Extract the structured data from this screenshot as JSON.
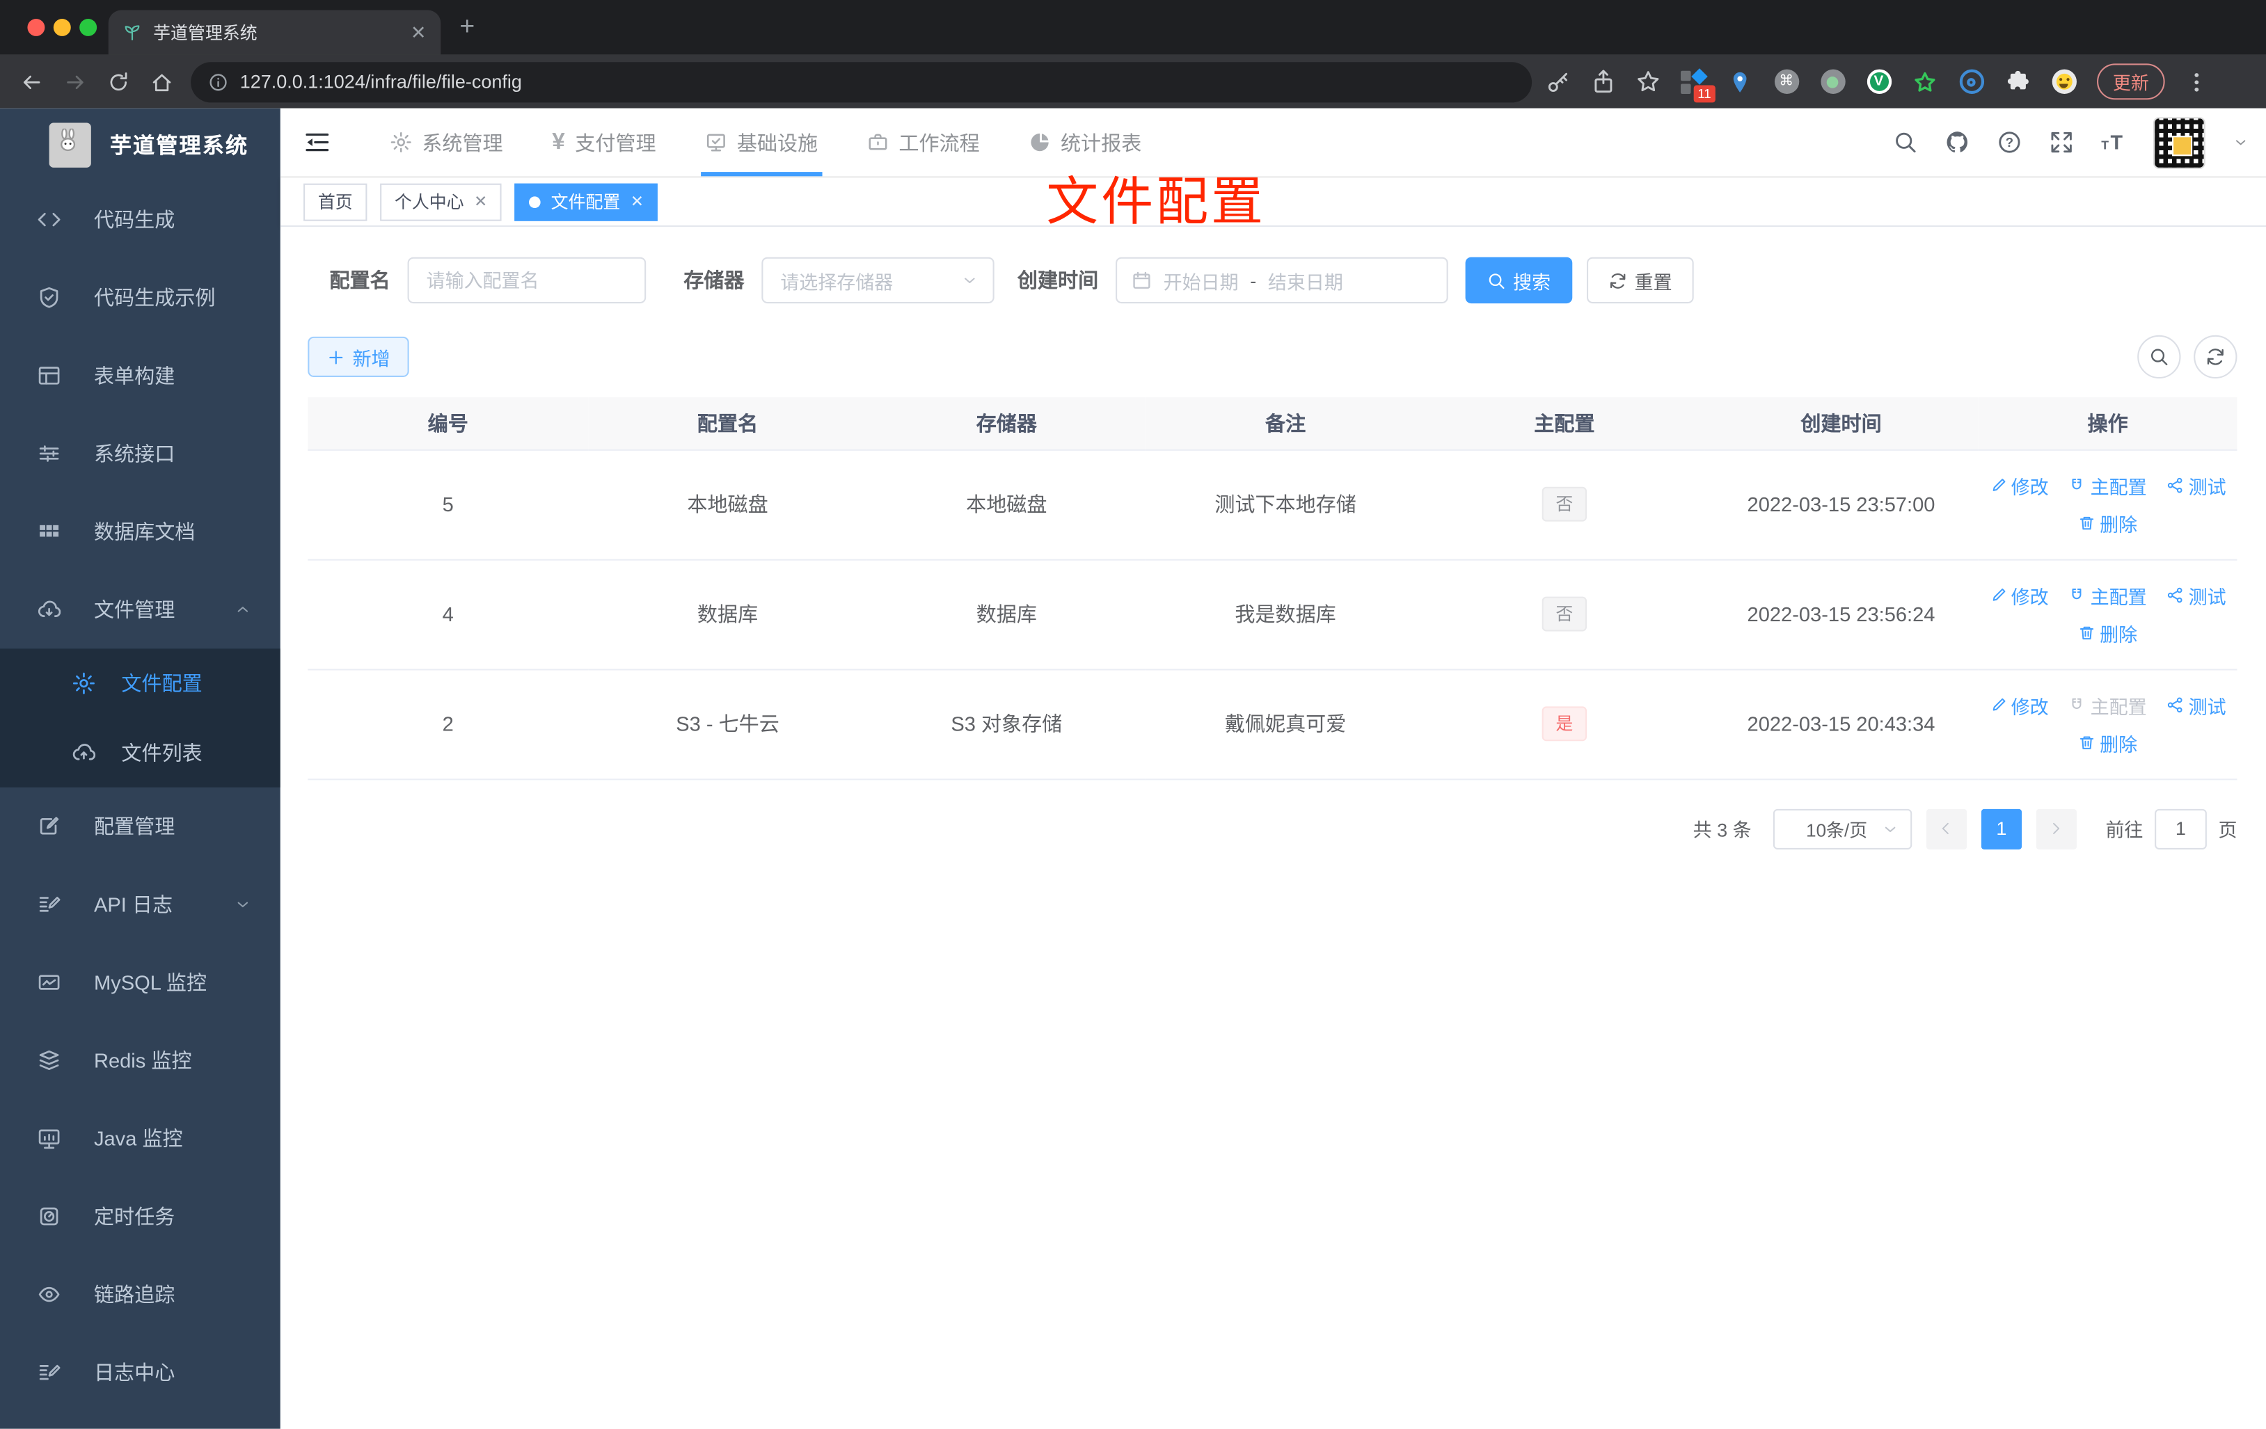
{
  "browser": {
    "tab_title": "芋道管理系统",
    "url": "127.0.0.1:1024/infra/file/file-config",
    "extension_badge": "11",
    "update_label": "更新"
  },
  "annotation": {
    "text": "文件配置"
  },
  "sidebar": {
    "title": "芋道管理系统",
    "items": [
      {
        "label": "代码生成"
      },
      {
        "label": "代码生成示例"
      },
      {
        "label": "表单构建"
      },
      {
        "label": "系统接口"
      },
      {
        "label": "数据库文档"
      },
      {
        "label": "文件管理"
      },
      {
        "label": "配置管理"
      },
      {
        "label": "API 日志"
      },
      {
        "label": "MySQL 监控"
      },
      {
        "label": "Redis 监控"
      },
      {
        "label": "Java 监控"
      },
      {
        "label": "定时任务"
      },
      {
        "label": "链路追踪"
      },
      {
        "label": "日志中心"
      }
    ],
    "submenu": [
      {
        "label": "文件配置",
        "active": true
      },
      {
        "label": "文件列表"
      }
    ]
  },
  "topnav": {
    "items": [
      {
        "label": "系统管理"
      },
      {
        "label": "支付管理"
      },
      {
        "label": "基础设施",
        "active": true
      },
      {
        "label": "工作流程"
      },
      {
        "label": "统计报表"
      }
    ]
  },
  "tagbar": {
    "tabs": [
      {
        "label": "首页"
      },
      {
        "label": "个人中心"
      },
      {
        "label": "文件配置",
        "active": true
      }
    ]
  },
  "filters": {
    "name_label": "配置名",
    "name_placeholder": "请输入配置名",
    "storage_label": "存储器",
    "storage_placeholder": "请选择存储器",
    "time_label": "创建时间",
    "start_placeholder": "开始日期",
    "range_separator": "-",
    "end_placeholder": "结束日期",
    "search_label": "搜索",
    "reset_label": "重置"
  },
  "toolbar": {
    "add_label": "新增"
  },
  "table": {
    "headers": [
      "编号",
      "配置名",
      "存储器",
      "备注",
      "主配置",
      "创建时间",
      "操作"
    ],
    "rows": [
      {
        "id": "5",
        "name": "本地磁盘",
        "storage": "本地磁盘",
        "remark": "测试下本地存储",
        "master": "否",
        "master_is_yes": false,
        "master_disabled": false,
        "created": "2022-03-15 23:57:00"
      },
      {
        "id": "4",
        "name": "数据库",
        "storage": "数据库",
        "remark": "我是数据库",
        "master": "否",
        "master_is_yes": false,
        "master_disabled": false,
        "created": "2022-03-15 23:56:24"
      },
      {
        "id": "2",
        "name": "S3 - 七牛云",
        "storage": "S3 对象存储",
        "remark": "戴佩妮真可爱",
        "master": "是",
        "master_is_yes": true,
        "master_disabled": true,
        "created": "2022-03-15 20:43:34"
      }
    ],
    "row_actions": {
      "edit": "修改",
      "master": "主配置",
      "test": "测试",
      "del": "删除"
    }
  },
  "pagination": {
    "total": "共 3 条",
    "page_size": "10条/页",
    "current": "1",
    "goto_label": "前往",
    "page_unit": "页"
  }
}
